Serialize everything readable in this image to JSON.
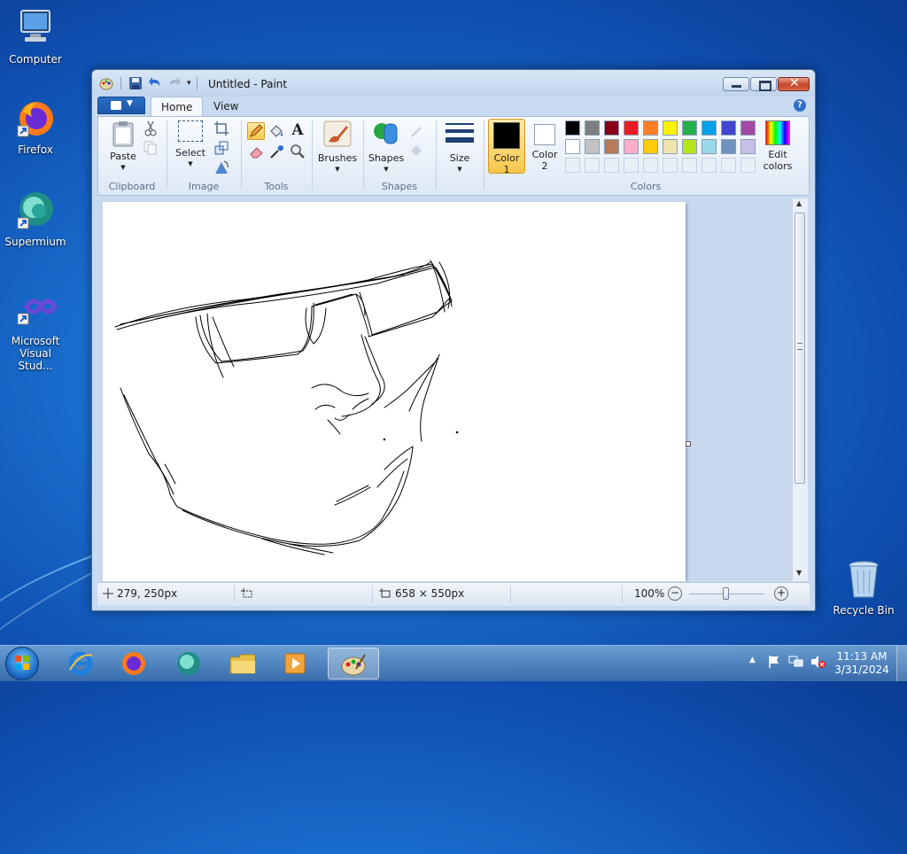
{
  "desktop": {
    "icons": [
      {
        "label": "Computer"
      },
      {
        "label": "Firefox"
      },
      {
        "label": "Supermium"
      },
      {
        "label": "Microsoft Visual Stud..."
      },
      {
        "label": "Recycle Bin"
      }
    ]
  },
  "window": {
    "title": "Untitled - Paint",
    "tabs": {
      "home": "Home",
      "view": "View"
    }
  },
  "ribbon": {
    "clipboard": {
      "label": "Clipboard",
      "paste": "Paste"
    },
    "image": {
      "label": "Image",
      "select": "Select"
    },
    "tools": {
      "label": "Tools"
    },
    "brushes": {
      "label": "Brushes"
    },
    "shapes": {
      "label": "Shapes",
      "button": "Shapes"
    },
    "size": {
      "label": "Size"
    },
    "colors": {
      "label": "Colors",
      "color1": "Color",
      "color1_num": "1",
      "color2": "Color",
      "color2_num": "2",
      "edit_line1": "Edit",
      "edit_line2": "colors",
      "color1_value": "#000000",
      "color2_value": "#ffffff",
      "palette_row1": [
        "#000000",
        "#7f7f7f",
        "#880015",
        "#ed1c24",
        "#ff7f27",
        "#fff200",
        "#22b14c",
        "#00a2e8",
        "#3f48cc",
        "#a349a4"
      ],
      "palette_row2": [
        "#ffffff",
        "#c3c3c3",
        "#b97a57",
        "#ffaec9",
        "#ffc90e",
        "#efe4b0",
        "#b5e61d",
        "#99d9ea",
        "#7092be",
        "#c8bfe7"
      ]
    }
  },
  "status": {
    "cursor_pos": "279, 250px",
    "canvas_size": "658 × 550px",
    "zoom": "100%"
  },
  "taskbar": {
    "time": "11:13 AM",
    "date": "3/31/2024"
  }
}
